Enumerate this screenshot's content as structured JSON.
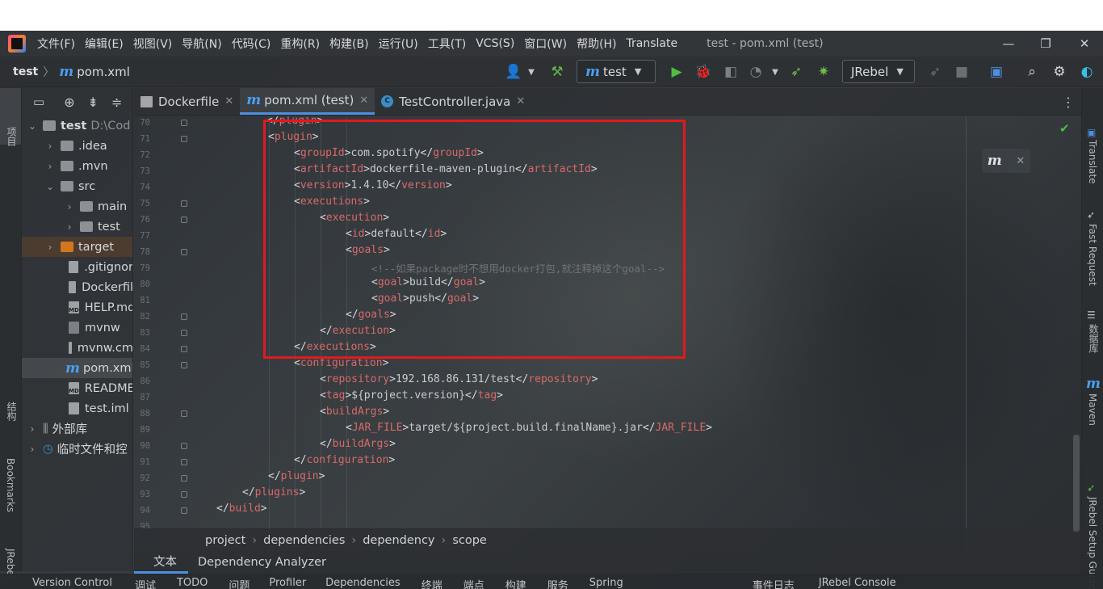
{
  "menu": {
    "items": [
      "文件(F)",
      "编辑(E)",
      "视图(V)",
      "导航(N)",
      "代码(C)",
      "重构(R)",
      "构建(B)",
      "运行(U)",
      "工具(T)",
      "VCS(S)",
      "窗口(W)",
      "帮助(H)",
      "Translate"
    ],
    "window_title": "test - pom.xml (test)"
  },
  "navbar": {
    "project": "test",
    "file": "pom.xml",
    "run_config": "test",
    "jrebel": "JRebel"
  },
  "left_stripe": {
    "project": "项目",
    "structure": "结构",
    "bookmarks": "Bookmarks",
    "jrebel": "JRebel"
  },
  "project_tree": {
    "rows": [
      {
        "label": "test",
        "extra": "D:\\Cod"
      },
      {
        "label": ".idea"
      },
      {
        "label": ".mvn"
      },
      {
        "label": "src"
      },
      {
        "label": "main"
      },
      {
        "label": "test"
      },
      {
        "label": "target"
      },
      {
        "label": ".gitignor"
      },
      {
        "label": "Dockerfil"
      },
      {
        "label": "HELP.md"
      },
      {
        "label": "mvnw"
      },
      {
        "label": "mvnw.cm"
      },
      {
        "label": "pom.xml"
      },
      {
        "label": "README"
      },
      {
        "label": "test.iml"
      },
      {
        "label": "外部库"
      },
      {
        "label": "临时文件和控"
      }
    ]
  },
  "tabs": [
    {
      "label": "Dockerfile"
    },
    {
      "label": "pom.xml (test)"
    },
    {
      "label": "TestController.java"
    }
  ],
  "editor": {
    "line_numbers": [
      "70",
      "71",
      "72",
      "73",
      "74",
      "75",
      "76",
      "77",
      "78",
      "79",
      "80",
      "81",
      "82",
      "83",
      "84",
      "85",
      "86",
      "87",
      "88",
      "89",
      "90",
      "91",
      "92",
      "93",
      "94",
      "95"
    ],
    "code": {
      "l70_close": "plugin",
      "l71": "plugin",
      "l72_tag": "groupId",
      "l72_val": "com.spotify",
      "l73_tag": "artifactId",
      "l73_val": "dockerfile-maven-plugin",
      "l74_tag": "version",
      "l74_val": "1.4.10",
      "l75": "executions",
      "l76": "execution",
      "l77_tag": "id",
      "l77_val": "default",
      "l78": "goals",
      "l79_comment": "<!--如果package时不想用docker打包,就注释掉这个goal-->",
      "l80_tag": "goal",
      "l80_val": "build",
      "l81_tag": "goal",
      "l81_val": "push",
      "l82": "goals",
      "l83": "execution",
      "l84": "executions",
      "l85": "configuration",
      "l86_tag": "repository",
      "l86_val": "192.168.86.131/test",
      "l87_tag": "tag",
      "l87_val": "${project.version}",
      "l88": "buildArgs",
      "l89_tag": "JAR_FILE",
      "l89_val": "target/${project.build.finalName}.jar",
      "l90": "buildArgs",
      "l91": "configuration",
      "l92": "plugin",
      "l93": "plugins",
      "l94": "build"
    }
  },
  "breadcrumb": [
    "project",
    "dependencies",
    "dependency",
    "scope"
  ],
  "subtabs": [
    "文本",
    "Dependency Analyzer"
  ],
  "statusbar": [
    "Version Control",
    "调试",
    "TODO",
    "问题",
    "Profiler",
    "Dependencies",
    "终端",
    "端点",
    "构建",
    "服务",
    "Spring",
    "事件日志",
    "JRebel Console"
  ],
  "right_stripe": {
    "translate": "Translate",
    "fast_request": "Fast Request",
    "database": "数据库",
    "maven": "Maven",
    "jrebel_setup": "JRebel Setup Guide"
  },
  "colors": {
    "highlight_box": "#e3191c",
    "accent": "#4d8fe0",
    "xml_tag": "#d86a6a",
    "run_green": "#4fbf3f"
  }
}
